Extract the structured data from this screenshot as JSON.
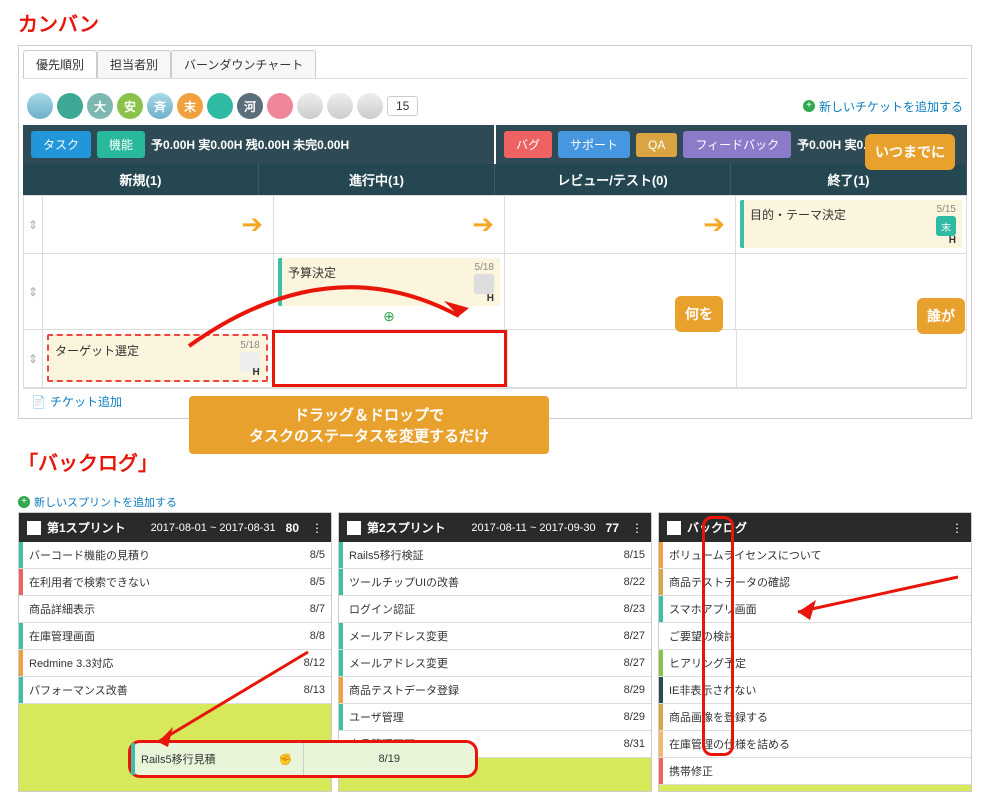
{
  "sections": {
    "kanban": "カンバン",
    "backlog": "「バックログ」"
  },
  "tabs": [
    "優先順別",
    "担当者別",
    "バーンダウンチャート"
  ],
  "avatars": [
    "",
    "",
    "大",
    "安",
    "斉",
    "末",
    "",
    "河",
    "",
    "",
    "",
    ""
  ],
  "avatar_count": "15",
  "add_ticket": "新しいチケットを追加する",
  "left_buttons": {
    "task": "タスク",
    "feature": "機能"
  },
  "right_buttons": {
    "bug": "バグ",
    "support": "サポート",
    "qa": "QA",
    "feedback": "フィードバック"
  },
  "stats_left": "予0.00H 実0.00H 残0.00H 未完0.00H",
  "stats_right": "予0.00H 実0.00H 残",
  "columns": [
    "新規(1)",
    "進行中(1)",
    "レビュー/テスト(0)",
    "終了(1)"
  ],
  "cards": {
    "done": {
      "title": "目的・テーマ決定",
      "date": "5/15",
      "assignee": "末",
      "h": "H"
    },
    "progress": {
      "title": "予算決定",
      "date": "5/18",
      "h": "H"
    },
    "new": {
      "title": "ターゲット選定",
      "date": "5/18",
      "h": "H"
    }
  },
  "ticket_add": "チケット追加",
  "callouts": {
    "when": "いつまでに",
    "what": "何を",
    "who": "誰が",
    "main1": "ドラッグ＆ドロップで",
    "main2": "タスクのステータスを変更するだけ"
  },
  "add_sprint": "新しいスプリントを追加する",
  "sprints": [
    {
      "title": "第1スプリント",
      "range": "2017-08-01 ~ 2017-08-31",
      "pts": "80",
      "stories": [
        {
          "c": "c-teal",
          "t": "バーコード機能の見積り",
          "p": "8/5"
        },
        {
          "c": "c-red",
          "t": "在利用者で検索できない",
          "p": "8/5"
        },
        {
          "c": "",
          "t": "商品詳細表示",
          "p": "8/7"
        },
        {
          "c": "c-teal",
          "t": "在庫管理画面",
          "p": "8/8"
        },
        {
          "c": "c-orange",
          "t": "Redmine 3.3対応",
          "p": "8/12"
        },
        {
          "c": "c-teal",
          "t": "パフォーマンス改善",
          "p": "8/13"
        }
      ]
    },
    {
      "title": "第2スプリント",
      "range": "2017-08-11 ~ 2017-09-30",
      "pts": "77",
      "stories": [
        {
          "c": "c-teal",
          "t": "Rails5移行検証",
          "p": "8/15"
        },
        {
          "c": "c-teal",
          "t": "ツールチップUIの改善",
          "p": "8/22"
        },
        {
          "c": "",
          "t": "ログイン認証",
          "p": "8/23"
        },
        {
          "c": "c-teal",
          "t": "メールアドレス変更",
          "p": "8/27"
        },
        {
          "c": "c-teal",
          "t": "メールアドレス変更",
          "p": "8/27"
        },
        {
          "c": "c-orange",
          "t": "商品テストデータ登録",
          "p": "8/29"
        },
        {
          "c": "c-teal",
          "t": "ユーザ管理",
          "p": "8/29"
        },
        {
          "c": "",
          "t": "商品管理画面",
          "p": "8/31"
        }
      ]
    },
    {
      "title": "バックログ",
      "range": "",
      "pts": "",
      "stories": [
        {
          "c": "c-orange",
          "t": "ボリュームライセンスについて",
          "p": ""
        },
        {
          "c": "c-gold",
          "t": "商品テストデータの確認",
          "p": ""
        },
        {
          "c": "c-teal",
          "t": "スマホアプリ画面",
          "p": ""
        },
        {
          "c": "",
          "t": "ご要望の検討",
          "p": ""
        },
        {
          "c": "c-green",
          "t": "ヒアリング予定",
          "p": ""
        },
        {
          "c": "c-navy",
          "t": "IE非表示されない",
          "p": ""
        },
        {
          "c": "c-gold",
          "t": "商品画像を登録する",
          "p": ""
        },
        {
          "c": "c-ltorange",
          "t": "在庫管理の仕様を詰める",
          "p": ""
        },
        {
          "c": "c-red",
          "t": "携帯修正",
          "p": ""
        }
      ]
    }
  ],
  "drag_story": {
    "title": "Rails5移行見積",
    "pts": "8/19"
  }
}
